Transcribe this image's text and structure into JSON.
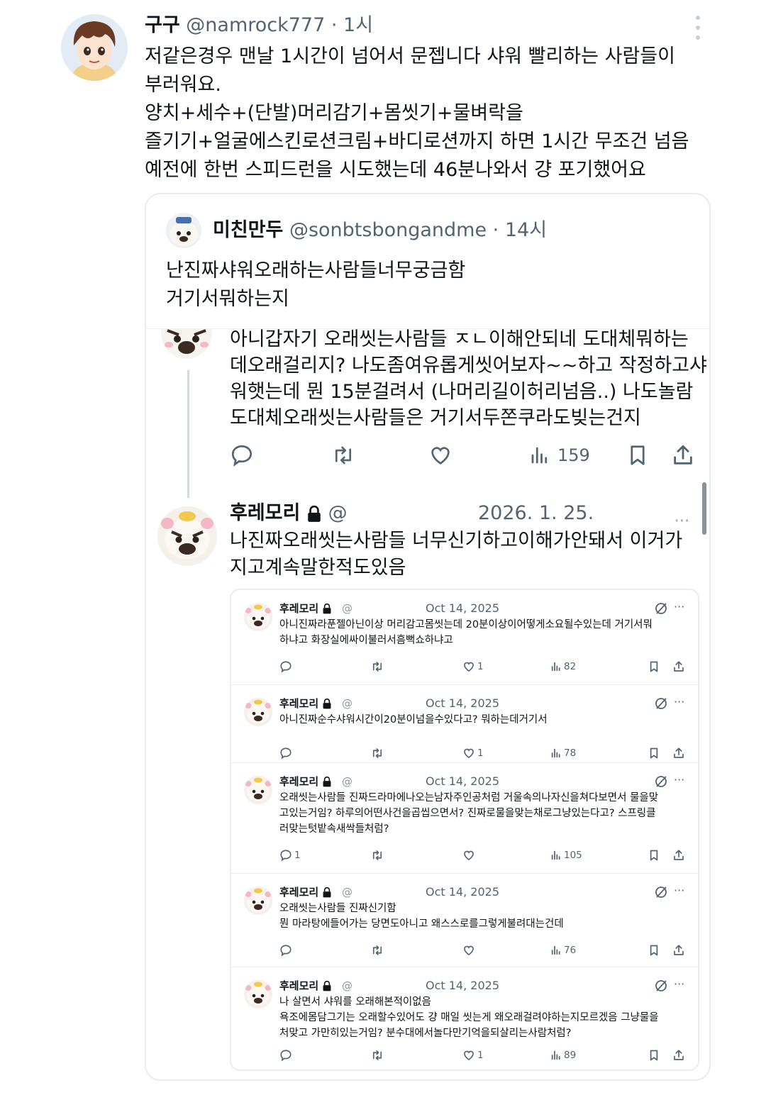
{
  "main_tweet": {
    "name": "구구",
    "handle": "@namrock777",
    "time": "· 1시",
    "lines": [
      "저같은경우 맨날 1시간이 넘어서 문젭니다 샤워 빨리하는 사람들이",
      "부러워요.",
      "양치+세수+(단발)머리감기+몸씻기+물벼락을",
      "즐기기+얼굴에스킨로션크림+바디로션까지 하면 1시간 무조건 넘음",
      "예전에 한번 스피드런을 시도했는데 46분나와서 걍 포기했어요"
    ]
  },
  "quoted_tweet": {
    "name": "미친만두",
    "handle": "@sonbtsbongandme",
    "time": "· 14시",
    "lines": [
      "난진짜샤워오래하는사람들너무궁금함",
      "거기서뭐하는지"
    ]
  },
  "thread_reply_1": {
    "lines": [
      "아니갑자기 오래씻는사람들 ㅈㄴ이해안되네 도대체뭐하는",
      "데오래걸리지? 나도좀여유롭게씻어보자~~하고 작정하고샤",
      "워햇는데 뭔 15분걸려서 (나머리길이허리넘음..) 나도놀람",
      "도대체오래씻는사람들은 거기서두쫀쿠라도빚는건지"
    ],
    "views": "159"
  },
  "thread_reply_2": {
    "name": "후레모리",
    "handle": "@",
    "date": "2026. 1. 25.",
    "more": "···",
    "lines": [
      "나진짜오래씻는사람들 너무신기하고이해가안돼서 이거가",
      "지고계속말한적도있음"
    ]
  },
  "nested_replies": [
    {
      "name": "후레모리",
      "handle": "@",
      "date": "Oct 14, 2025",
      "lines": [
        "아니진짜라푼젤아닌이상 머리감고몸씻는데 20분이상이어떻게소요될수있는데 거기서뭐",
        "하냐고 화장실에싸이불러서흠뻑쇼하냐고"
      ],
      "replies": "",
      "likes": "1",
      "views": "82"
    },
    {
      "name": "후레모리",
      "handle": "@",
      "date": "Oct 14, 2025",
      "lines": [
        "아니진짜순수샤워시간이20분이넘을수있다고? 뭐하는데거기서"
      ],
      "replies": "",
      "likes": "1",
      "views": "78"
    },
    {
      "name": "후레모리",
      "handle": "@",
      "date": "Oct 14, 2025",
      "lines": [
        "오래씻는사람들 진짜드라마에나오는남자주인공처럼 거울속의나자신을쳐다보면서 물을맞",
        "고있는거임? 하루의어떤사건을곱씹으면서? 진짜로물을맞는채로그냥있는다고? 스프링클",
        "러맞는텃밭속새싹들처럼?"
      ],
      "replies": "1",
      "likes": "",
      "views": "105"
    },
    {
      "name": "후레모리",
      "handle": "@",
      "date": "Oct 14, 2025",
      "lines": [
        "오래씻는사람들 진짜신기함",
        "뭔 마라탕에들어가는 당면도아니고 왜스스로를그렇게불려대는건데"
      ],
      "replies": "",
      "likes": "",
      "views": "76"
    },
    {
      "name": "후레모리",
      "handle": "@",
      "date": "Oct 14, 2025",
      "lines": [
        "나 살면서 샤워를 오래해본적이없음",
        "욕조에몸담그기는 오래할수있어도 걍 매일 씻는게 왜오래걸려야하는지모르겠음 그냥물을",
        "처맞고 가만히있는거임? 분수대에서놀다만기억을되살리는사람처럼?"
      ],
      "replies": "",
      "likes": "1",
      "views": "89"
    }
  ],
  "colors": {
    "text": "#0f1419",
    "muted": "#536471",
    "border": "#e6ecf0"
  }
}
